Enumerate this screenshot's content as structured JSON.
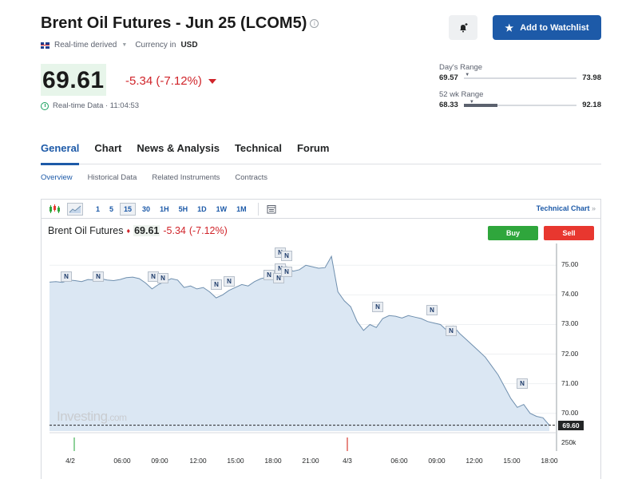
{
  "header": {
    "title": "Brent Oil Futures - Jun 25 (LCOM5)",
    "info_icon": "i",
    "realtime_label": "Real-time derived",
    "currency_label": "Currency in",
    "currency": "USD",
    "add_watchlist": "Add to Watchlist"
  },
  "quote": {
    "price": "69.61",
    "change": "-5.34",
    "change_pct": "(-7.12%)",
    "rt_data": "Real-time Data · 11:04:53"
  },
  "day_range": {
    "label": "Day's Range",
    "low": "69.57",
    "high": "73.98",
    "position": 0.01
  },
  "week52_range": {
    "label": "52 wk Range",
    "low": "68.33",
    "high": "92.18",
    "position": 0.05
  },
  "tabs": [
    "General",
    "Chart",
    "News & Analysis",
    "Technical",
    "Forum"
  ],
  "subtabs": [
    "Overview",
    "Historical Data",
    "Related Instruments",
    "Contracts"
  ],
  "chart_toolbar": {
    "intervals": [
      "1",
      "5",
      "15",
      "30",
      "1H",
      "5H",
      "1D",
      "1W",
      "1M"
    ],
    "active_interval": "15",
    "tech_link": "Technical Chart",
    "tech_link_arrow": "»"
  },
  "chart": {
    "instrument": "Brent Oil Futures",
    "last": "69.61",
    "change": "-5.34",
    "change_pct": "(-7.12%)",
    "buy": "Buy",
    "sell": "Sell",
    "watermark": "Investing",
    "watermark_suffix": ".com",
    "last_tag": "69.60",
    "volume_label": "250k",
    "news_badge": "N",
    "colors": {
      "line": "#6f8fae",
      "area": "#dbe7f3",
      "buy": "#2fa63c",
      "sell": "#e8372f",
      "accent": "#1d5aa8"
    }
  },
  "chart_data": {
    "type": "area",
    "x": [
      "4/2",
      "06:00",
      "09:00",
      "12:00",
      "15:00",
      "18:00",
      "21:00",
      "4/3",
      "06:00",
      "09:00",
      "12:00",
      "15:00",
      "18:00"
    ],
    "y_ticks": [
      "75.00",
      "74.00",
      "73.00",
      "72.00",
      "71.00",
      "70.00"
    ],
    "ylim": [
      69.4,
      75.6
    ],
    "series": [
      {
        "values": [
          74.43,
          74.45,
          74.42,
          74.5,
          74.48,
          74.45,
          74.52,
          74.5,
          74.55,
          74.5,
          74.48,
          74.52,
          74.58,
          74.6,
          74.55,
          74.4,
          74.2,
          74.35,
          74.45,
          74.55,
          74.5,
          74.25,
          74.3,
          74.2,
          74.25,
          74.1,
          73.9,
          74.0,
          74.15,
          74.25,
          74.35,
          74.3,
          74.45,
          74.55,
          74.6,
          74.7,
          74.9,
          74.95,
          74.8,
          74.85,
          75.0,
          74.95,
          74.9,
          74.92,
          75.3,
          74.1,
          73.8,
          73.6,
          73.1,
          72.8,
          73.0,
          72.9,
          73.2,
          73.3,
          73.28,
          73.22,
          73.3,
          73.25,
          73.2,
          73.1,
          73.05,
          73.0,
          72.8,
          72.95,
          72.7,
          72.5,
          72.3,
          72.1,
          71.9,
          71.6,
          71.3,
          70.9,
          70.5,
          70.2,
          70.3,
          70.0,
          69.9,
          69.85,
          69.6
        ]
      }
    ],
    "last_value": 69.6
  }
}
